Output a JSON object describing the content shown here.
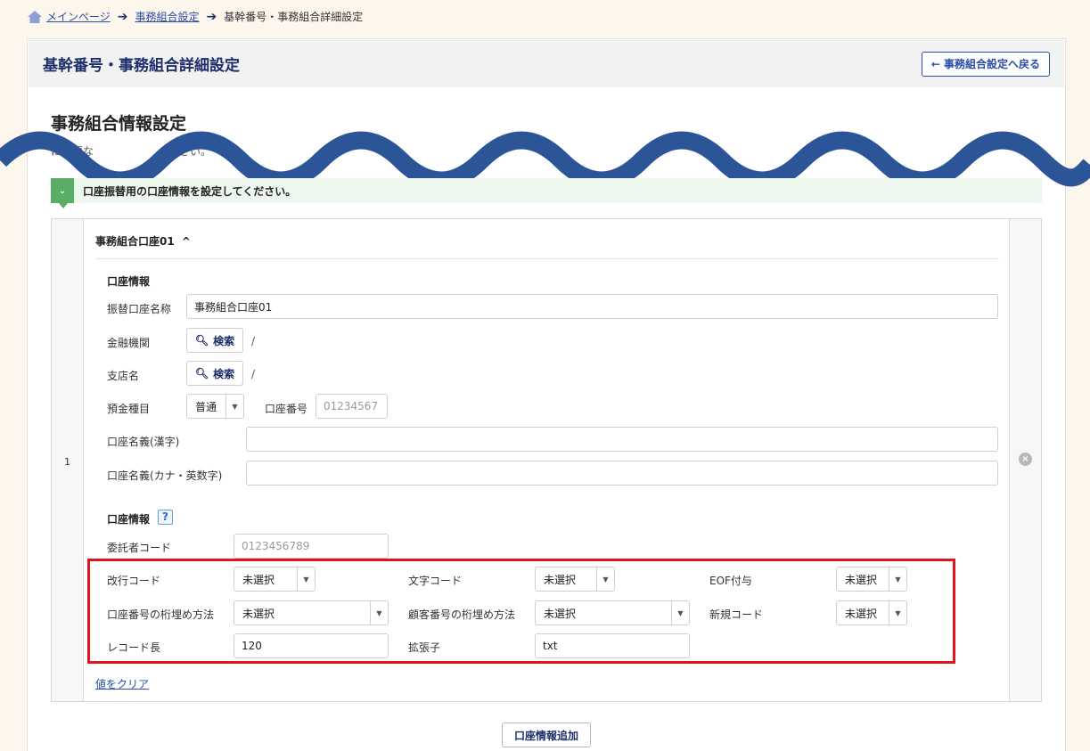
{
  "breadcrumb": {
    "home": "メインページ",
    "union_settings": "事務組合設定",
    "current": "基幹番号・事務組合詳細設定"
  },
  "header": {
    "title": "基幹番号・事務組合詳細設定",
    "back_button": "事務組合設定へ戻る"
  },
  "section": {
    "title": "事務組合情報設定",
    "description": "に必要な　　　　　　　ださい。"
  },
  "notice": "口座振替用の口座情報を設定してください。",
  "account": {
    "index": "1",
    "heading": "事務組合口座01",
    "info_label": "口座情報",
    "transfer_name_label": "振替口座名称",
    "transfer_name_value": "事務組合口座01",
    "bank_label": "金融機関",
    "branch_label": "支店名",
    "search_label": "検索",
    "slash": "/",
    "deposit_type_label": "預金種目",
    "deposit_type_value": "普通",
    "account_number_label": "口座番号",
    "account_number_placeholder": "01234567",
    "holder_kanji_label": "口座名義(漢字)",
    "holder_kana_label": "口座名義(カナ・英数字)",
    "info2_label": "口座情報",
    "help": "?",
    "consignor_code_label": "委託者コード",
    "consignor_code_placeholder": "0123456789",
    "newline_code_label": "改行コード",
    "newline_code_value": "未選択",
    "char_code_label": "文字コード",
    "char_code_value": "未選択",
    "eof_label": "EOF付与",
    "eof_value": "未選択",
    "acct_pad_label": "口座番号の桁埋め方法",
    "acct_pad_value": "未選択",
    "cust_pad_label": "顧客番号の桁埋め方法",
    "cust_pad_value": "未選択",
    "new_code_label": "新規コード",
    "new_code_value": "未選択",
    "record_length_label": "レコード長",
    "record_length_value": "120",
    "extension_label": "拡張子",
    "extension_value": "txt",
    "clear_link": "値をクリア"
  },
  "add_button": "口座情報追加",
  "colors": {
    "accent": "#1c2e6a",
    "link": "#2a4ea8",
    "notice": "#5aad65",
    "highlight": "#e0141b",
    "wave": "#2c5597"
  }
}
